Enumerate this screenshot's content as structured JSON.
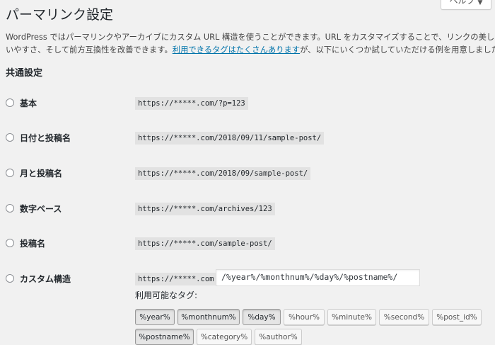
{
  "header": {
    "title": "パーマリンク設定",
    "help_label": "ヘルプ"
  },
  "intro": {
    "line1": "WordPress ではパーマリンクやアーカイブにカスタム URL 構造を使うことができます。URL をカスタマイズすることで、リンクの美しさや使",
    "line2_before": "いやすさ、そして前方互換性を改善できます。",
    "line2_link": "利用できるタグはたくさんあります",
    "line2_after": "が、以下にいくつか試していただける例を用意しました。"
  },
  "section": {
    "title": "共通設定"
  },
  "options": [
    {
      "label": "基本",
      "example": "https://*****.com/?p=123",
      "selected": false
    },
    {
      "label": "日付と投稿名",
      "example": "https://*****.com/2018/09/11/sample-post/",
      "selected": false
    },
    {
      "label": "月と投稿名",
      "example": "https://*****.com/2018/09/sample-post/",
      "selected": false
    },
    {
      "label": "数字ベース",
      "example": "https://*****.com/archives/123",
      "selected": false
    },
    {
      "label": "投稿名",
      "example": "https://*****.com/sample-post/",
      "selected": false
    },
    {
      "label": "カスタム構造",
      "example": "https://*****.com",
      "selected": false
    }
  ],
  "custom_structure": {
    "value": "/%year%/%monthnum%/%day%/%postname%/",
    "tags_label": "利用可能なタグ:"
  },
  "tags": [
    {
      "label": "%year%",
      "active": true
    },
    {
      "label": "%monthnum%",
      "active": true
    },
    {
      "label": "%day%",
      "active": true
    },
    {
      "label": "%hour%",
      "active": false
    },
    {
      "label": "%minute%",
      "active": false
    },
    {
      "label": "%second%",
      "active": false
    },
    {
      "label": "%post_id%",
      "active": false
    },
    {
      "label": "%postname%",
      "active": true
    },
    {
      "label": "%category%",
      "active": false
    },
    {
      "label": "%author%",
      "active": false
    }
  ]
}
